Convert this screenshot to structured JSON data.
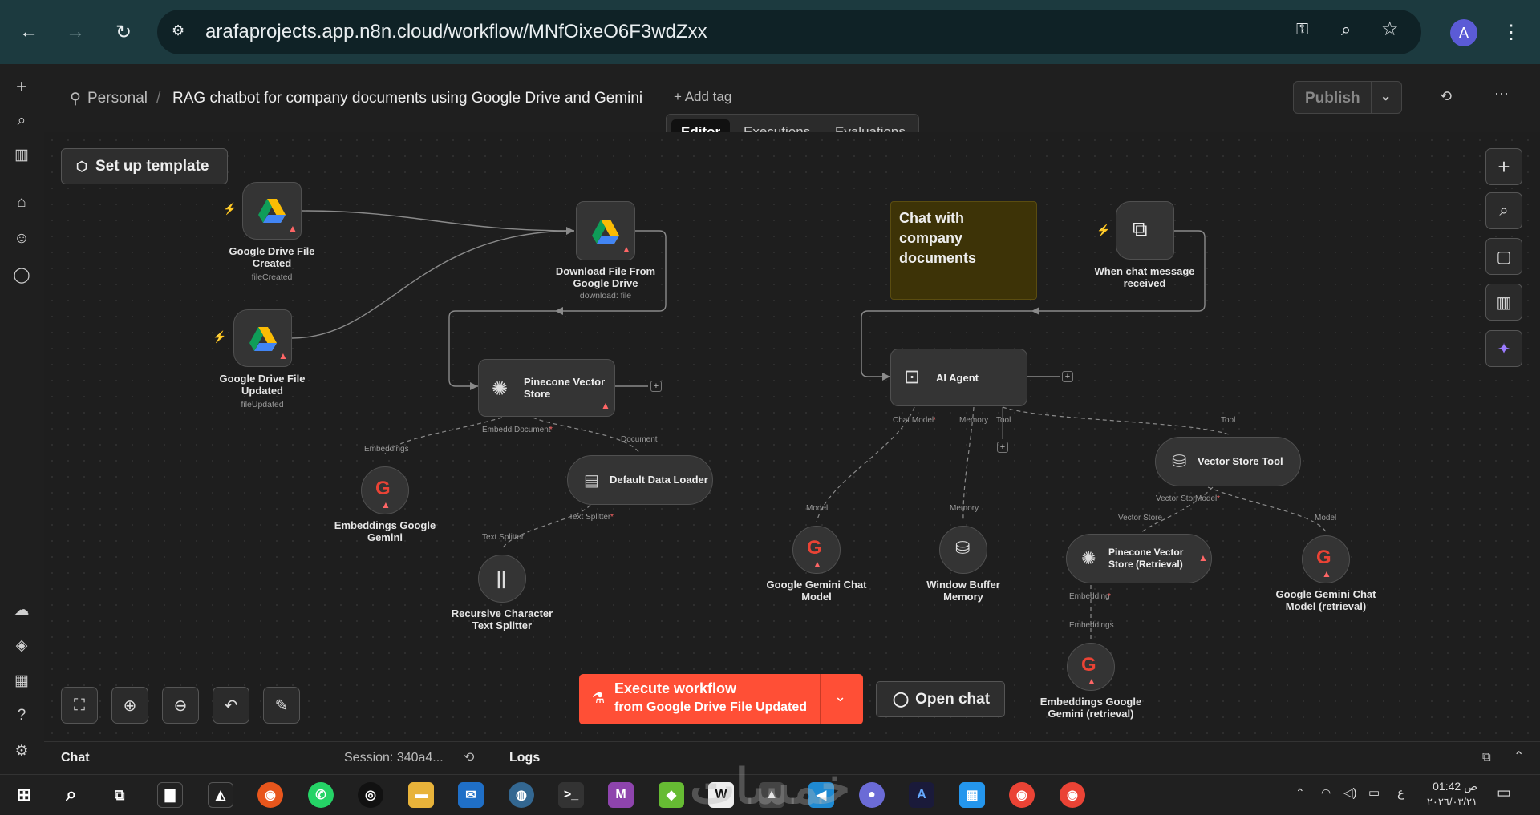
{
  "browser": {
    "url": "arafaprojects.app.n8n.cloud/workflow/MNfOixeO6F3wdZxx",
    "avatar_letter": "A"
  },
  "header": {
    "breadcrumb_personal": "Personal",
    "workflow_title": "RAG chatbot for company documents using Google Drive and Gemini",
    "add_tag": "+ Add tag",
    "publish": "Publish"
  },
  "tabs": [
    "Editor",
    "Executions",
    "Evaluations"
  ],
  "canvas": {
    "setup_template": "Set up template",
    "sticky_note": "Chat with company documents",
    "nodes": {
      "gd_created": {
        "label": "Google Drive File Created",
        "sub": "fileCreated"
      },
      "gd_updated": {
        "label": "Google Drive File Updated",
        "sub": "fileUpdated"
      },
      "download": {
        "label": "Download File From Google Drive",
        "sub": "download: file"
      },
      "pinecone": {
        "label": "Pinecone Vector Store"
      },
      "embeddings": {
        "label": "Embeddings Google Gemini"
      },
      "loader": {
        "label": "Default Data Loader"
      },
      "splitter": {
        "label": "Recursive Character Text Splitter"
      },
      "chat_trigger": {
        "label": "When chat message received"
      },
      "agent": {
        "label": "AI Agent"
      },
      "gemini_chat": {
        "label": "Google Gemini Chat Model"
      },
      "buffer": {
        "label": "Window Buffer Memory"
      },
      "vstool": {
        "label": "Vector Store Tool"
      },
      "pinecone_ret": {
        "label": "Pinecone Vector Store (Retrieval)"
      },
      "gemini_ret": {
        "label": "Google Gemini Chat Model (retrieval)"
      },
      "emb_ret": {
        "label": "Embeddings Google Gemini (retrieval)"
      }
    },
    "slot_labels": {
      "embeddings_in": "Embeddings",
      "pinecone_embeddi": "Embeddi",
      "pinecone_document": "Document",
      "document_out": "Document",
      "text_splitter_in": "Text Splitter",
      "text_splitter_out": "Text Splitter",
      "chat_model": "Chat Model",
      "memory": "Memory",
      "tool": "Tool",
      "tool_in": "Tool",
      "model_in": "Model",
      "memory_in": "Memory",
      "vs_store": "Vector Stor",
      "vs_model": "Model",
      "vector_store_in": "Vector Store",
      "model_in2": "Model",
      "embedding": "Embedding",
      "embeddings_in2": "Embeddings"
    },
    "execute_title": "Execute workflow",
    "execute_sub": "from Google Drive File Updated",
    "open_chat": "Open chat"
  },
  "bottom": {
    "chat": "Chat",
    "session": "Session: 340a4...",
    "logs": "Logs"
  },
  "taskbar": {
    "time": "01:42 ص",
    "date": "٢٠٢٦/٠٣/٢١",
    "lang": "ع",
    "watermark": "خمسات"
  },
  "colors": {
    "accent": "#ff6d5a",
    "sticky": "#3d3307",
    "warning": "#f87171"
  }
}
